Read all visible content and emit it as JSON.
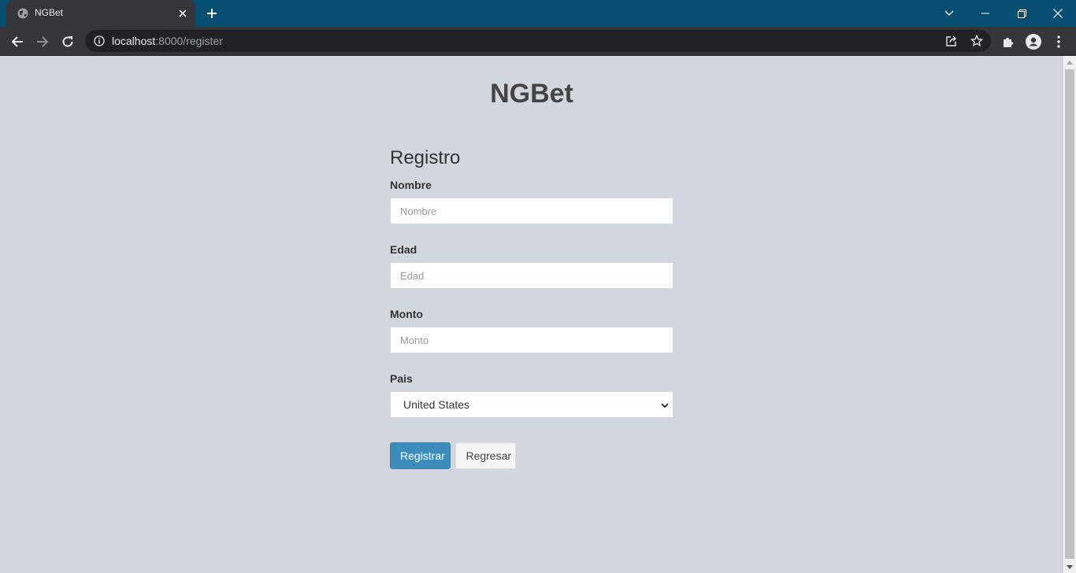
{
  "browser": {
    "tab_title": "NGBet",
    "url_host": "localhost",
    "url_rest": ":8000/register"
  },
  "page": {
    "brand": "NGBet",
    "form_title": "Registro",
    "fields": {
      "nombre": {
        "label": "Nombre",
        "placeholder": "Nombre",
        "value": ""
      },
      "edad": {
        "label": "Edad",
        "placeholder": "Edad",
        "value": ""
      },
      "monto": {
        "label": "Monto",
        "placeholder": "Monto",
        "value": ""
      },
      "pais": {
        "label": "Pais",
        "selected": "United States"
      }
    },
    "buttons": {
      "submit": "Registrar",
      "back": "Regresar"
    }
  },
  "colors": {
    "titlebar": "#074f72",
    "page_background": "#d2d6de",
    "primary_button": "#3c8dbc"
  }
}
